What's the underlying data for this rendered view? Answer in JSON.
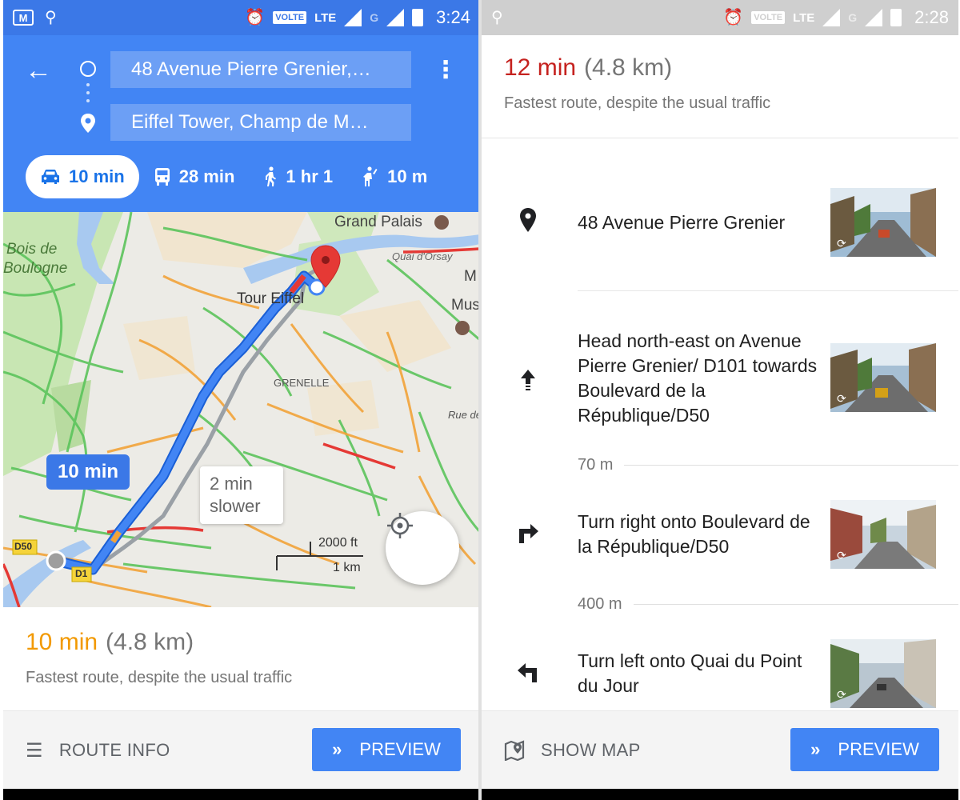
{
  "left": {
    "status": {
      "time": "3:24",
      "volte": "VOLTE",
      "lte": "LTE",
      "g": "G"
    },
    "route": {
      "origin": "48 Avenue Pierre Grenier,…",
      "destination": "Eiffel Tower, Champ de M…"
    },
    "modes": [
      {
        "icon": "car-icon",
        "label": "10 min",
        "active": true
      },
      {
        "icon": "transit-icon",
        "label": "28 min"
      },
      {
        "icon": "walk-icon",
        "label": "1 hr 1"
      },
      {
        "icon": "ride-icon",
        "label": "10 m"
      }
    ],
    "map": {
      "labels": {
        "grand_palais": "Grand Palais",
        "quai_orsay": "Quai d'Orsay",
        "bois": "Bois de",
        "boulogne": "Boulogne",
        "tour_eiffel": "Tour Eiffel",
        "m": "M",
        "mus": "Mus",
        "grenelle": "GRENELLE",
        "rue_de": "Rue de",
        "d50": "D50",
        "d1": "D1"
      },
      "route_time": "10 min",
      "alt_line1": "2 min",
      "alt_line2": "slower",
      "scale_ft": "2000 ft",
      "scale_km": "1 km",
      "colors": {
        "route": "#4285f4",
        "alt_route": "#9aa0a6",
        "traffic_green": "#5cc45c",
        "traffic_orange": "#f2a33a",
        "traffic_red": "#e53935",
        "park": "#c8e6b3",
        "water": "#a8c9f0"
      }
    },
    "summary": {
      "time": "10 min",
      "distance": "(4.8 km)",
      "desc": "Fastest route, despite the usual traffic"
    },
    "bottom": {
      "left_label": "ROUTE INFO",
      "left_icon": "list-icon",
      "preview_label": "PREVIEW",
      "preview_icon": "double-chevron-icon"
    }
  },
  "right": {
    "status": {
      "time": "2:28",
      "volte": "VOLTE",
      "lte": "LTE",
      "g": "G"
    },
    "summary": {
      "time": "12 min",
      "distance": "(4.8 km)",
      "desc": "Fastest route, despite the usual traffic"
    },
    "steps": [
      {
        "icon": "place-pin-icon",
        "text": "48 Avenue Pierre Grenier"
      },
      {
        "icon": "arrow-up-icon",
        "text": "Head north-east on Avenue Pierre Grenier/ D101 towards Boulevard de la République/D50"
      },
      {
        "icon": "turn-right-icon",
        "text": "Turn right onto Boulevard de la République/D50"
      },
      {
        "icon": "turn-left-icon",
        "text": "Turn left onto Quai du Point du Jour"
      }
    ],
    "distances": [
      "70 m",
      "400 m"
    ],
    "bottom": {
      "left_label": "SHOW MAP",
      "left_icon": "map-pin-icon",
      "preview_label": "PREVIEW",
      "preview_icon": "double-chevron-icon"
    }
  }
}
